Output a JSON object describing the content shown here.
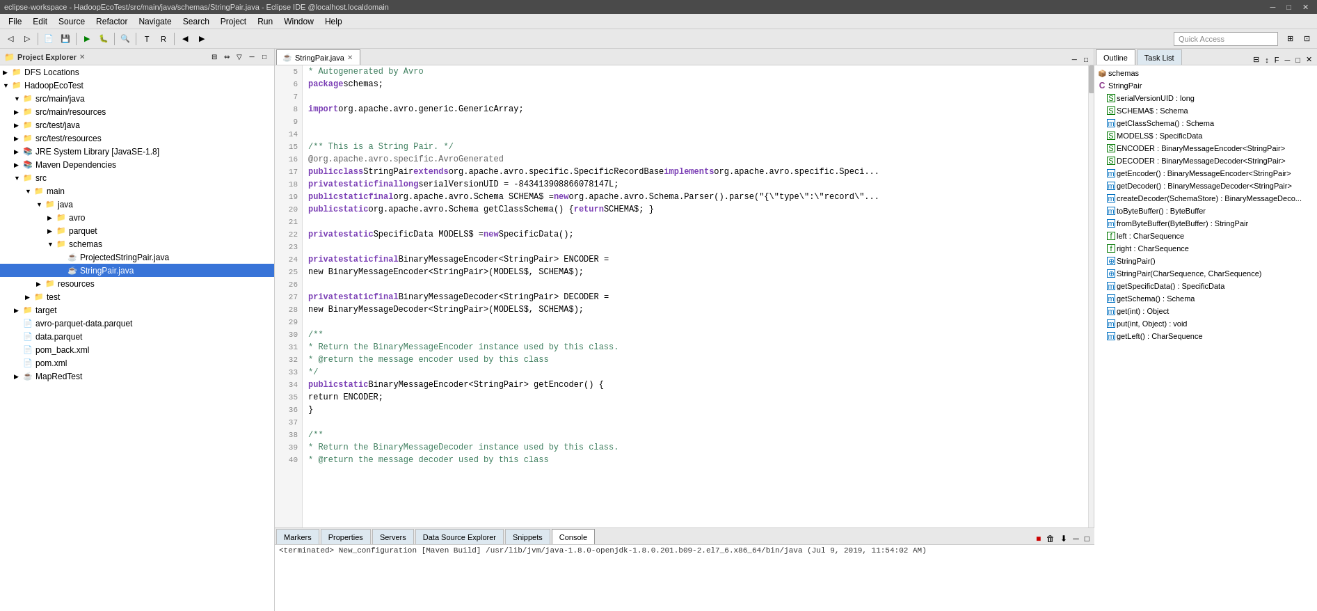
{
  "titlebar": {
    "text": "eclipse-workspace - HadoopEcoTest/src/main/java/schemas/StringPair.java - Eclipse IDE @localhost.localdomain"
  },
  "menubar": {
    "items": [
      "File",
      "Edit",
      "Source",
      "Refactor",
      "Navigate",
      "Search",
      "Project",
      "Run",
      "Window",
      "Help"
    ]
  },
  "toolbar": {
    "quick_access_placeholder": "Quick Access"
  },
  "left_panel": {
    "title": "Project Explorer",
    "close_label": "×",
    "tree": [
      {
        "id": "dfs",
        "label": "DFS Locations",
        "indent": 0,
        "arrow": "▶",
        "icon": "📁",
        "selected": false
      },
      {
        "id": "hadoop",
        "label": "HadoopEcoTest",
        "indent": 0,
        "arrow": "▼",
        "icon": "📁",
        "selected": false
      },
      {
        "id": "src-main-java",
        "label": "src/main/java",
        "indent": 1,
        "arrow": "▼",
        "icon": "📁",
        "selected": false
      },
      {
        "id": "src-main-res",
        "label": "src/main/resources",
        "indent": 1,
        "arrow": "▶",
        "icon": "📁",
        "selected": false
      },
      {
        "id": "src-test-java",
        "label": "src/test/java",
        "indent": 1,
        "arrow": "▶",
        "icon": "📁",
        "selected": false
      },
      {
        "id": "src-test-res",
        "label": "src/test/resources",
        "indent": 1,
        "arrow": "▶",
        "icon": "📁",
        "selected": false
      },
      {
        "id": "jre",
        "label": "JRE System Library [JavaSE-1.8]",
        "indent": 1,
        "arrow": "▶",
        "icon": "📚",
        "selected": false
      },
      {
        "id": "maven",
        "label": "Maven Dependencies",
        "indent": 1,
        "arrow": "▶",
        "icon": "📚",
        "selected": false
      },
      {
        "id": "src",
        "label": "src",
        "indent": 1,
        "arrow": "▼",
        "icon": "📁",
        "selected": false
      },
      {
        "id": "main",
        "label": "main",
        "indent": 2,
        "arrow": "▼",
        "icon": "📁",
        "selected": false
      },
      {
        "id": "java",
        "label": "java",
        "indent": 3,
        "arrow": "▼",
        "icon": "📁",
        "selected": false
      },
      {
        "id": "avro",
        "label": "avro",
        "indent": 4,
        "arrow": "▶",
        "icon": "📁",
        "selected": false
      },
      {
        "id": "parquet",
        "label": "parquet",
        "indent": 4,
        "arrow": "▶",
        "icon": "📁",
        "selected": false
      },
      {
        "id": "schemas",
        "label": "schemas",
        "indent": 4,
        "arrow": "▼",
        "icon": "📁",
        "selected": false
      },
      {
        "id": "projected",
        "label": "ProjectedStringPair.java",
        "indent": 5,
        "arrow": "",
        "icon": "☕",
        "selected": false
      },
      {
        "id": "stringpair",
        "label": "StringPair.java",
        "indent": 5,
        "arrow": "",
        "icon": "☕",
        "selected": true
      },
      {
        "id": "resources",
        "label": "resources",
        "indent": 3,
        "arrow": "▶",
        "icon": "📁",
        "selected": false
      },
      {
        "id": "test",
        "label": "test",
        "indent": 2,
        "arrow": "▶",
        "icon": "📁",
        "selected": false
      },
      {
        "id": "target",
        "label": "target",
        "indent": 1,
        "arrow": "▶",
        "icon": "📁",
        "selected": false
      },
      {
        "id": "avro-parquet",
        "label": "avro-parquet-data.parquet",
        "indent": 1,
        "arrow": "",
        "icon": "📄",
        "selected": false
      },
      {
        "id": "data-parquet",
        "label": "data.parquet",
        "indent": 1,
        "arrow": "",
        "icon": "📄",
        "selected": false
      },
      {
        "id": "pom-back",
        "label": "pom_back.xml",
        "indent": 1,
        "arrow": "",
        "icon": "📄",
        "selected": false
      },
      {
        "id": "pom",
        "label": "pom.xml",
        "indent": 1,
        "arrow": "",
        "icon": "📄",
        "selected": false
      },
      {
        "id": "mapred",
        "label": "MapRedTest",
        "indent": 1,
        "arrow": "▶",
        "icon": "☕",
        "selected": false
      }
    ]
  },
  "editor": {
    "tab_label": "StringPair.java",
    "tab_icon": "☕",
    "lines": [
      {
        "num": "5",
        "code": " * Autogenerated by Avro"
      },
      {
        "num": "6",
        "code": "package schemas;"
      },
      {
        "num": "7",
        "code": ""
      },
      {
        "num": "8",
        "code": "import org.apache.avro.generic.GenericArray;"
      },
      {
        "num": "9",
        "code": ""
      },
      {
        "num": "14",
        "code": ""
      },
      {
        "num": "15",
        "code": "/** This is a String Pair. */"
      },
      {
        "num": "16",
        "code": "@org.apache.avro.specific.AvroGenerated"
      },
      {
        "num": "17",
        "code": "public class StringPair extends org.apache.avro.specific.SpecificRecordBase implements org.apache.avro.specific.Speci..."
      },
      {
        "num": "18",
        "code": "    private static final long serialVersionUID = -843413908866078147L;"
      },
      {
        "num": "19",
        "code": "    public static final org.apache.avro.Schema SCHEMA$ = new org.apache.avro.Schema.Parser().parse(\"{\\\"type\\\":\\\"record\\\"..."
      },
      {
        "num": "20",
        "code": "    public static org.apache.avro.Schema getClassSchema() { return SCHEMA$; }"
      },
      {
        "num": "21",
        "code": ""
      },
      {
        "num": "22",
        "code": "    private static SpecificData MODELS$ = new SpecificData();"
      },
      {
        "num": "23",
        "code": ""
      },
      {
        "num": "24",
        "code": "    private static final BinaryMessageEncoder<StringPair> ENCODER ="
      },
      {
        "num": "25",
        "code": "        new BinaryMessageEncoder<StringPair>(MODELS$, SCHEMA$);"
      },
      {
        "num": "26",
        "code": ""
      },
      {
        "num": "27",
        "code": "    private static final BinaryMessageDecoder<StringPair> DECODER ="
      },
      {
        "num": "28",
        "code": "        new BinaryMessageDecoder<StringPair>(MODELS$, SCHEMA$);"
      },
      {
        "num": "29",
        "code": ""
      },
      {
        "num": "30",
        "code": "    /**"
      },
      {
        "num": "31",
        "code": "     * Return the BinaryMessageEncoder instance used by this class."
      },
      {
        "num": "32",
        "code": "     * @return the message encoder used by this class"
      },
      {
        "num": "33",
        "code": "     */"
      },
      {
        "num": "34",
        "code": "    public static BinaryMessageEncoder<StringPair> getEncoder() {"
      },
      {
        "num": "35",
        "code": "        return ENCODER;"
      },
      {
        "num": "36",
        "code": "    }"
      },
      {
        "num": "37",
        "code": ""
      },
      {
        "num": "38",
        "code": "    /**"
      },
      {
        "num": "39",
        "code": "     * Return the BinaryMessageDecoder instance used by this class."
      },
      {
        "num": "40",
        "code": "     * @return the message decoder used by this class"
      }
    ]
  },
  "outline": {
    "tabs": [
      {
        "label": "Outline",
        "active": true
      },
      {
        "label": "Task List",
        "active": false
      }
    ],
    "items": [
      {
        "indent": 0,
        "icon": "pkg",
        "label": "schemas",
        "type": "package"
      },
      {
        "indent": 0,
        "icon": "class",
        "label": "StringPair",
        "type": "class"
      },
      {
        "indent": 1,
        "icon": "field-s",
        "label": "serialVersionUID : long",
        "type": "field"
      },
      {
        "indent": 1,
        "icon": "field-s",
        "label": "SCHEMA$ : Schema",
        "type": "field"
      },
      {
        "indent": 1,
        "icon": "method",
        "label": "getClassSchema() : Schema",
        "type": "method"
      },
      {
        "indent": 1,
        "icon": "field-s",
        "label": "MODELS$ : SpecificData",
        "type": "field"
      },
      {
        "indent": 1,
        "icon": "field-s",
        "label": "ENCODER : BinaryMessageEncoder<StringPair>",
        "type": "field"
      },
      {
        "indent": 1,
        "icon": "field-s",
        "label": "DECODER : BinaryMessageDecoder<StringPair>",
        "type": "field"
      },
      {
        "indent": 1,
        "icon": "method",
        "label": "getEncoder() : BinaryMessageEncoder<StringPair>",
        "type": "method"
      },
      {
        "indent": 1,
        "icon": "method",
        "label": "getDecoder() : BinaryMessageDecoder<StringPair>",
        "type": "method"
      },
      {
        "indent": 1,
        "icon": "method",
        "label": "createDecoder(SchemaStore) : BinaryMessageDeco...",
        "type": "method"
      },
      {
        "indent": 1,
        "icon": "method",
        "label": "toByteBuffer() : ByteBuffer",
        "type": "method"
      },
      {
        "indent": 1,
        "icon": "method-s",
        "label": "fromByteBuffer(ByteBuffer) : StringPair",
        "type": "method"
      },
      {
        "indent": 1,
        "icon": "field",
        "label": "left : CharSequence",
        "type": "field"
      },
      {
        "indent": 1,
        "icon": "field",
        "label": "right : CharSequence",
        "type": "field"
      },
      {
        "indent": 1,
        "icon": "constructor",
        "label": "StringPair()",
        "type": "constructor"
      },
      {
        "indent": 1,
        "icon": "constructor",
        "label": "StringPair(CharSequence, CharSequence)",
        "type": "constructor"
      },
      {
        "indent": 1,
        "icon": "method",
        "label": "getSpecificData() : SpecificData",
        "type": "method"
      },
      {
        "indent": 1,
        "icon": "method",
        "label": "getSchema() : Schema",
        "type": "method"
      },
      {
        "indent": 1,
        "icon": "method",
        "label": "get(int) : Object",
        "type": "method"
      },
      {
        "indent": 1,
        "icon": "method",
        "label": "put(int, Object) : void",
        "type": "method"
      },
      {
        "indent": 1,
        "icon": "method",
        "label": "getLeft() : CharSequence",
        "type": "method"
      }
    ]
  },
  "bottom": {
    "tabs": [
      "Markers",
      "Properties",
      "Servers",
      "Data Source Explorer",
      "Snippets",
      "Console"
    ],
    "active_tab": "Console",
    "console_text": "<terminated> New_configuration [Maven Build] /usr/lib/jvm/java-1.8.0-openjdk-1.8.0.201.b09-2.el7_6.x86_64/bin/java (Jul 9, 2019, 11:54:02 AM)"
  }
}
